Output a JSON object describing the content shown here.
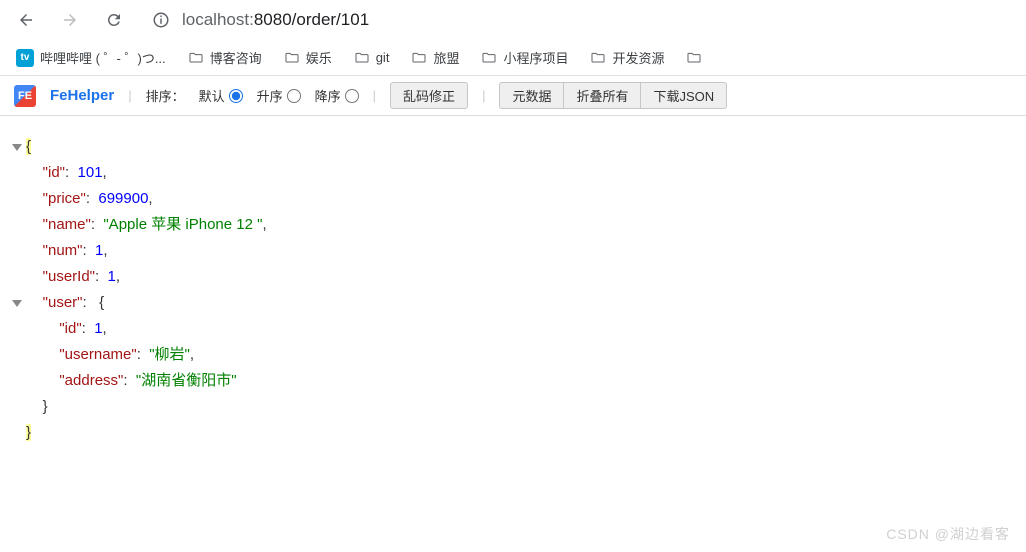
{
  "nav": {
    "url_host": "localhost:",
    "url_port_path": "8080/order/101"
  },
  "bookmarks": [
    {
      "icon": "bili",
      "label": "哔哩哔哩 (  ゜- ゜)つ..."
    },
    {
      "icon": "folder",
      "label": "博客咨询"
    },
    {
      "icon": "folder",
      "label": "娱乐"
    },
    {
      "icon": "folder",
      "label": "git"
    },
    {
      "icon": "folder",
      "label": "旅盟"
    },
    {
      "icon": "folder",
      "label": "小程序项目"
    },
    {
      "icon": "folder",
      "label": "开发资源"
    },
    {
      "icon": "folder",
      "label": ""
    }
  ],
  "toolbar": {
    "brand": "FeHelper",
    "sort_label": "排序：",
    "sort_default": "默认",
    "sort_asc": "升序",
    "sort_desc": "降序",
    "charset_fix": "乱码修正",
    "metadata": "元数据",
    "collapse_all": "折叠所有",
    "download_json": "下载JSON"
  },
  "json_response": {
    "id": 101,
    "price": 699900,
    "name": "Apple 苹果 iPhone 12 ",
    "num": 1,
    "userId": 1,
    "user": {
      "id": 1,
      "username": "柳岩",
      "address": "湖南省衡阳市"
    }
  },
  "watermark": "CSDN @湖边看客"
}
